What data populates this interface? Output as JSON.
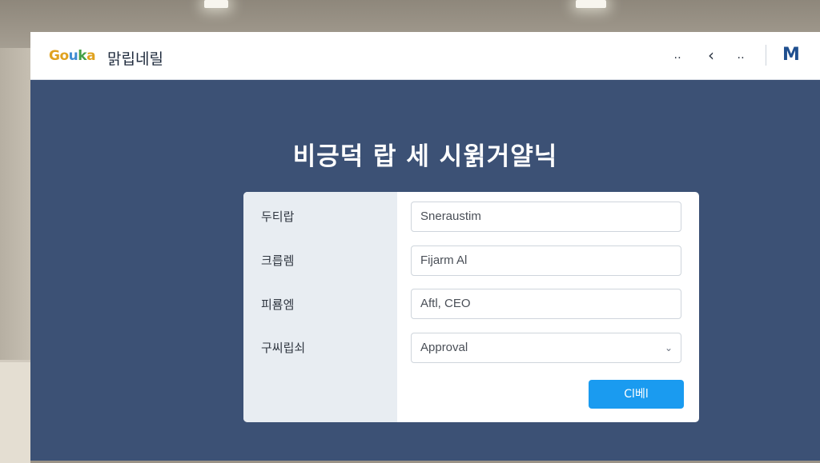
{
  "app": {
    "logo_parts": [
      "Go",
      "u",
      "k",
      "a"
    ],
    "name": "맑립네릴"
  },
  "toolbar": {
    "btn1": "‥",
    "btn2": "‹",
    "btn3": "‥",
    "brand_icon": "M"
  },
  "page": {
    "heading": "비긍덕 랍 세 시윍거얄닉"
  },
  "form": {
    "rows": [
      {
        "label": "두티랍",
        "value": "Sneraustim"
      },
      {
        "label": "크릅렘",
        "value": "Fijarm Al"
      },
      {
        "label": "피룜엠",
        "value": "Aftl, CEO"
      },
      {
        "label": "구씨립쇠",
        "value": "Approval"
      }
    ],
    "submit_label": "Cl베l"
  },
  "colors": {
    "window_bg": "#3c5175",
    "accent": "#1a9bf0",
    "label_column": "#e8edf2"
  },
  "icons": [
    "menu-dots-icon",
    "back-chevron-icon",
    "more-dots-icon",
    "brand-m-icon",
    "chevron-down-icon"
  ]
}
